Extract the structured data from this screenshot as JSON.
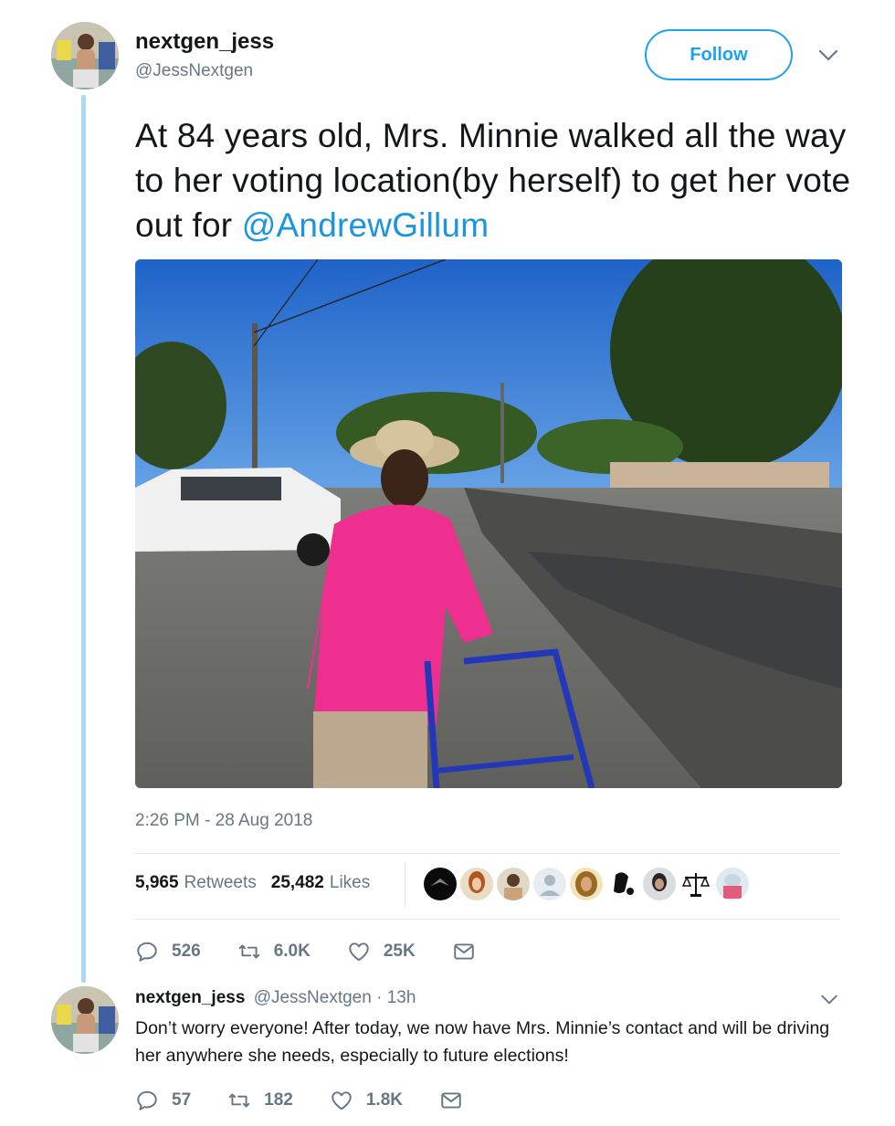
{
  "tweet": {
    "display_name": "nextgen_jess",
    "handle": "@JessNextgen",
    "follow_label": "Follow",
    "text_prefix": "At 84 years old, Mrs. Minnie walked all the way to her voting location(by herself) to get her vote out for ",
    "mention": "@AndrewGillum",
    "timestamp": "2:26 PM - 28 Aug 2018",
    "retweets_count": "5,965",
    "retweets_label": "Retweets",
    "likes_count": "25,482",
    "likes_label": "Likes",
    "actions": {
      "replies": "526",
      "retweets": "6.0K",
      "likes": "25K"
    }
  },
  "reply": {
    "display_name": "nextgen_jess",
    "handle": "@JessNextgen",
    "time": "· 13h",
    "text": "Don’t worry everyone! After today, we now have Mrs. Minnie’s contact and will be driving her anywhere she needs, especially to future elections!",
    "actions": {
      "replies": "57",
      "retweets": "182",
      "likes": "1.8K"
    }
  },
  "colors": {
    "accent": "#1da1f2",
    "mention": "#1b95e0",
    "muted": "#657786",
    "thread_line": "#a9d8f0"
  },
  "icons": [
    "reply-icon",
    "retweet-icon",
    "like-icon",
    "message-icon",
    "chevron-down-icon"
  ]
}
